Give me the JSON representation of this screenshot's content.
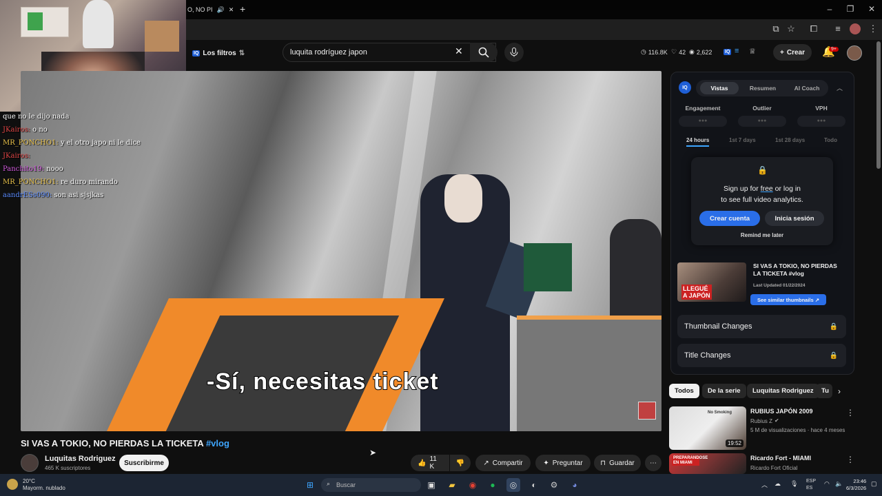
{
  "browser": {
    "tab_title": "O, NO PI",
    "new_tab": "+",
    "window": {
      "min": "–",
      "max": "❐",
      "close": "✕"
    }
  },
  "header": {
    "filters_label": "Los filtros",
    "vidiq_chip": "IQ",
    "search_value": "luquita rodríguez japon",
    "stats": {
      "views": "116.8K",
      "likes": "42",
      "comments": "2,622"
    },
    "create_label": "Crear",
    "notifications": "9+"
  },
  "chat": [
    {
      "user": "",
      "user_color": "#ffffff",
      "text": "que no le dijo nada"
    },
    {
      "user": "JKairos",
      "user_color": "#e04545",
      "text": "o no"
    },
    {
      "user": "MR_PONCHO1",
      "user_color": "#e8c14a",
      "text": "y el otro japo ni le dice"
    },
    {
      "user": "JKairos",
      "user_color": "#e04545",
      "text": ""
    },
    {
      "user": "Panchito19",
      "user_color": "#d45be0",
      "text": "nooo"
    },
    {
      "user": "MR_PONCHO1",
      "user_color": "#e8c14a",
      "text": "re duro mirando"
    },
    {
      "user": "aandrESs090",
      "user_color": "#5b8cff",
      "text": "son asi sjsjkas"
    }
  ],
  "video": {
    "subtitle": "-Sí, necesitas ticket",
    "title": "SI VAS A TOKIO, NO PIERDAS LA TICKETA",
    "hashtag": "#vlog",
    "channel": "Luquitas Rodriguez",
    "subscribers": "465 K suscriptores",
    "subscribe_label": "Suscribirme",
    "likes": "11 K",
    "share_label": "Compartir",
    "ask_label": "Preguntar",
    "save_label": "Guardar"
  },
  "panel": {
    "logo": "IQ",
    "tabs": [
      "Vistas",
      "Resumen",
      "AI Coach"
    ],
    "metrics": [
      "Engagement",
      "Outlier",
      "VPH"
    ],
    "metric_placeholder": "●●●",
    "ranges": [
      "24 hours",
      "1st 7 days",
      "1st 28 days",
      "Todo"
    ],
    "signup_text_1": "Sign up for ",
    "signup_free": "free",
    "signup_text_2": " or log in",
    "signup_text_3": "to see full video analytics.",
    "create_account": "Crear cuenta",
    "login": "Inicia sesión",
    "remind": "Remind me later",
    "thumb_title": "SI VAS A TOKIO, NO PIERDAS LA TICKETA #vlog",
    "thumb_caption": "LLEGUÉ A JAPÓN",
    "last_updated": "Last Updated 01/22/2024",
    "see_similar": "See similar thumbnails ↗",
    "rows": [
      "Thumbnail Changes",
      "Title Changes"
    ]
  },
  "rec_chips": [
    "Todos",
    "De la serie",
    "Luquitas Rodriguez",
    "Tu"
  ],
  "recommendations": [
    {
      "title": "RUBIUS JAPÓN 2009",
      "channel": "Rubius Z",
      "meta": "5 M de visualizaciones · hace 4 meses",
      "duration": "19:52",
      "sign": "No Smoking"
    },
    {
      "title": "Ricardo Fort - MIAMI",
      "channel": "Ricardo Fort Oficial",
      "meta": "",
      "duration": "",
      "banner": "PREPARANDOSE EN MIAMI"
    }
  ],
  "taskbar": {
    "temp": "20°C",
    "weather": "Mayorm. nublado",
    "search": "Buscar",
    "lang_1": "ESP",
    "lang_2": "ES",
    "time": "23:46",
    "date": "6/3/2026"
  },
  "colors": {
    "accent": "#2a6ee8",
    "link": "#3ea6ff",
    "bg": "#0f0f0f"
  }
}
